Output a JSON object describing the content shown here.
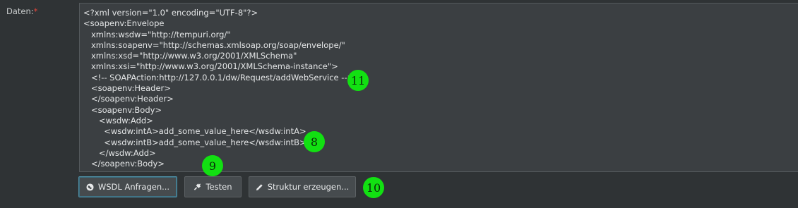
{
  "field": {
    "label": "Daten:",
    "required_mark": "*"
  },
  "editor": {
    "lines": [
      "<?xml version=\"1.0\" encoding=\"UTF-8\"?>",
      "<soapenv:Envelope",
      "   xmlns:wsdw=\"http://tempuri.org/\"",
      "   xmlns:soapenv=\"http://schemas.xmlsoap.org/soap/envelope/\"",
      "   xmlns:xsd=\"http://www.w3.org/2001/XMLSchema\"",
      "   xmlns:xsi=\"http://www.w3.org/2001/XMLSchema-instance\">",
      "   <!-- SOAPAction:http://127.0.0.1/dw/Request/addWebService -->",
      "   <soapenv:Header>",
      "   </soapenv:Header>",
      "   <soapenv:Body>",
      "      <wsdw:Add>",
      "        <wsdw:intA>add_some_value_here</wsdw:intA>",
      "        <wsdw:intB>add_some_value_here</wsdw:intB>",
      "      </wsdw:Add>",
      "   </soapenv:Body>"
    ]
  },
  "toolbar": {
    "wsdl_label": "WSDL Anfragen...",
    "wsdl_icon": "globe-icon",
    "test_label": "Testen",
    "test_icon": "plug-icon",
    "struct_label": "Struktur erzeugen...",
    "struct_icon": "pencil-icon"
  },
  "markers": {
    "m8": "8",
    "m9": "9",
    "m10": "10",
    "m11": "11"
  },
  "colors": {
    "marker": "#12e012",
    "required": "#e0453a",
    "focus": "#4f8fa6"
  }
}
